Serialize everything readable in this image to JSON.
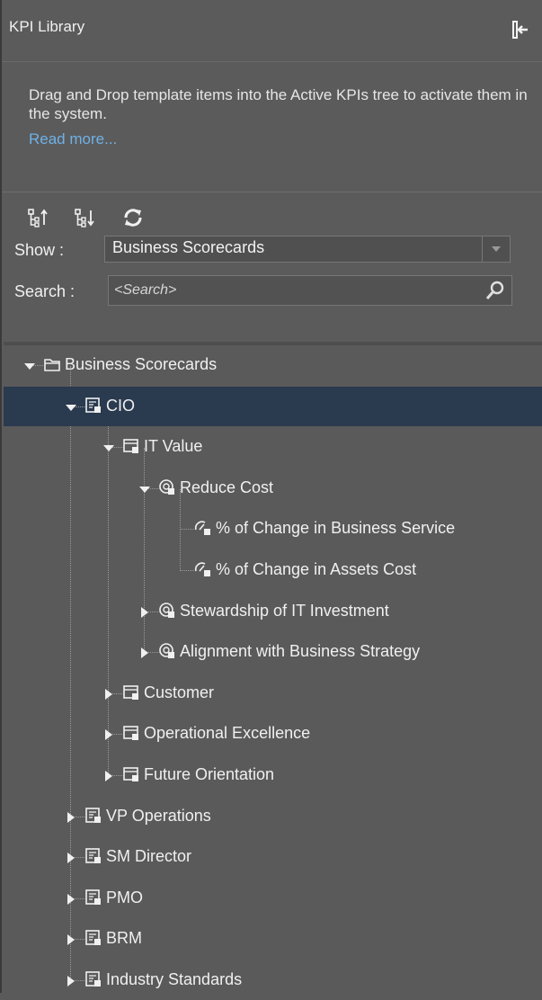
{
  "panel": {
    "title": "KPI Library",
    "description": "Drag and Drop template items into the Active KPIs tree to activate them in the system.",
    "read_more": "Read more..."
  },
  "toolbar": {
    "tools": [
      "expand-all-icon",
      "collapse-all-icon",
      "refresh-icon"
    ]
  },
  "filters": {
    "show_label": "Show :",
    "show_value": "Business Scorecards",
    "search_label": "Search :",
    "search_placeholder": "<Search>"
  },
  "tree": [
    {
      "label": "Business Scorecards",
      "level": 0,
      "icon": "folder-icon",
      "state": "expanded"
    },
    {
      "label": "CIO",
      "level": 1,
      "icon": "scorecard-icon",
      "state": "expanded",
      "selected": true
    },
    {
      "label": "IT Value",
      "level": 2,
      "icon": "perspective-icon",
      "state": "expanded"
    },
    {
      "label": "Reduce Cost",
      "level": 3,
      "icon": "objective-icon",
      "state": "expanded"
    },
    {
      "label": "% of Change in Business Service",
      "level": 4,
      "icon": "kpi-icon",
      "state": "leaf"
    },
    {
      "label": "% of Change in Assets Cost",
      "level": 4,
      "icon": "kpi-icon",
      "state": "leaf"
    },
    {
      "label": "Stewardship of IT Investment",
      "level": 3,
      "icon": "objective-icon",
      "state": "collapsed"
    },
    {
      "label": "Alignment with Business Strategy",
      "level": 3,
      "icon": "objective-icon",
      "state": "collapsed"
    },
    {
      "label": "Customer",
      "level": 2,
      "icon": "perspective-icon",
      "state": "collapsed"
    },
    {
      "label": "Operational Excellence",
      "level": 2,
      "icon": "perspective-icon",
      "state": "collapsed"
    },
    {
      "label": "Future Orientation",
      "level": 2,
      "icon": "perspective-icon",
      "state": "collapsed"
    },
    {
      "label": "VP Operations",
      "level": 1,
      "icon": "scorecard-icon",
      "state": "collapsed"
    },
    {
      "label": "SM Director",
      "level": 1,
      "icon": "scorecard-icon",
      "state": "collapsed"
    },
    {
      "label": "PMO",
      "level": 1,
      "icon": "scorecard-icon",
      "state": "collapsed"
    },
    {
      "label": "BRM",
      "level": 1,
      "icon": "scorecard-icon",
      "state": "collapsed"
    },
    {
      "label": "Industry Standards",
      "level": 1,
      "icon": "scorecard-icon",
      "state": "collapsed"
    }
  ],
  "colors": {
    "panel_bg": "#5b5b5b",
    "selected_row": "#2a3a4f",
    "link": "#6fb1e6"
  }
}
